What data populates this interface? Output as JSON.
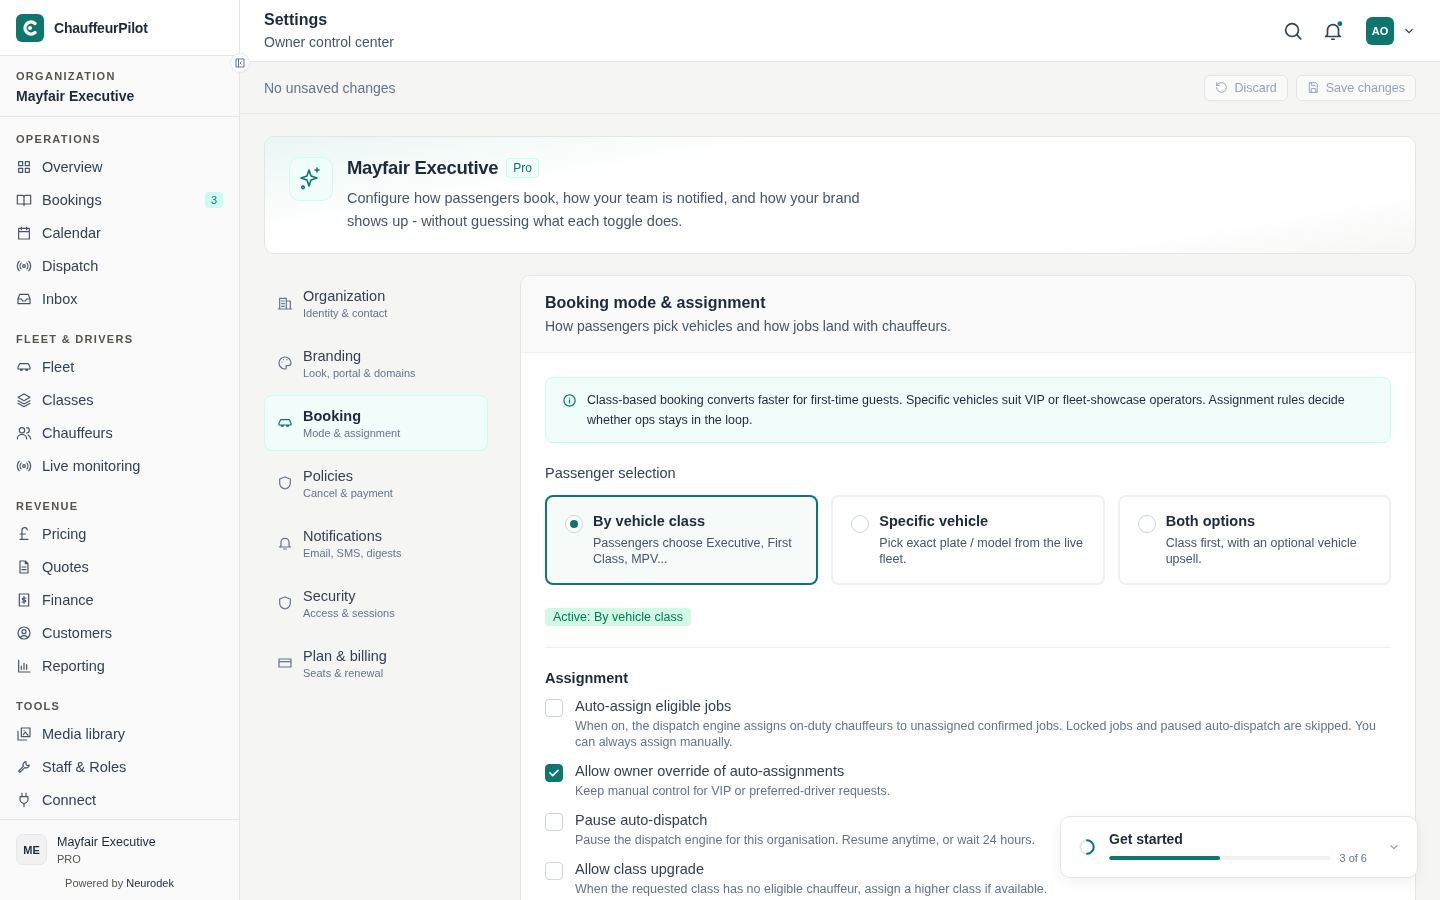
{
  "brand": {
    "name": "ChauffeurPilot"
  },
  "organization": {
    "label": "ORGANIZATION",
    "name": "Mayfair Executive"
  },
  "nav_sections": [
    {
      "title": "OPERATIONS",
      "items": [
        {
          "label": "Overview"
        },
        {
          "label": "Bookings",
          "badge": "3"
        },
        {
          "label": "Calendar"
        },
        {
          "label": "Dispatch"
        },
        {
          "label": "Inbox"
        }
      ]
    },
    {
      "title": "FLEET & DRIVERS",
      "items": [
        {
          "label": "Fleet"
        },
        {
          "label": "Classes"
        },
        {
          "label": "Chauffeurs"
        },
        {
          "label": "Live monitoring"
        }
      ]
    },
    {
      "title": "REVENUE",
      "items": [
        {
          "label": "Pricing"
        },
        {
          "label": "Quotes"
        },
        {
          "label": "Finance"
        },
        {
          "label": "Customers"
        },
        {
          "label": "Reporting"
        }
      ]
    },
    {
      "title": "TOOLS",
      "items": [
        {
          "label": "Media library"
        },
        {
          "label": "Staff & Roles"
        },
        {
          "label": "Connect"
        }
      ]
    }
  ],
  "account": {
    "initials": "ME",
    "name": "Mayfair Executive",
    "plan": "PRO"
  },
  "powered_by": "Powered by **Neurodek**",
  "header": {
    "title": "Settings",
    "subtitle": "Owner control center",
    "avatar": "AO",
    "notification_dot": true
  },
  "save_bar": {
    "status": "No unsaved changes",
    "buttons": [
      {
        "label": "Discard",
        "disabled": true
      },
      {
        "label": "Save changes",
        "disabled": true
      }
    ]
  },
  "hero": {
    "title": "Mayfair Executive",
    "badge": "Pro",
    "description": "Configure how passengers book, how your team is notified, and how your brand shows up - without guessing what each toggle does."
  },
  "settings_nav": [
    {
      "label": "Organization",
      "sub": "Identity & contact",
      "selected": false
    },
    {
      "label": "Branding",
      "sub": "Look, portal & domains",
      "selected": false
    },
    {
      "label": "Booking",
      "sub": "Mode & assignment",
      "selected": true
    },
    {
      "label": "Policies",
      "sub": "Cancel & payment",
      "selected": false
    },
    {
      "label": "Notifications",
      "sub": "Email, SMS, digests",
      "selected": false
    },
    {
      "label": "Security",
      "sub": "Access & sessions",
      "selected": false
    },
    {
      "label": "Plan & billing",
      "sub": "Seats & renewal",
      "selected": false
    }
  ],
  "panel": {
    "title": "Booking mode & assignment",
    "subtitle": "How passengers pick vehicles and how jobs land with chauffeurs.",
    "info": "Class-based booking converts faster for first-time guests. Specific vehicles suit VIP or fleet-showcase operators. Assignment rules decide whether ops stays in the loop.",
    "selection_label": "Passenger selection",
    "options": [
      {
        "title": "By vehicle class",
        "description": "Passengers choose Executive, First Class, MPV...",
        "selected": true
      },
      {
        "title": "Specific vehicle",
        "description": "Pick exact plate / model from the live fleet.",
        "selected": false
      },
      {
        "title": "Both options",
        "description": "Class first, with an optional vehicle upsell.",
        "selected": false
      }
    ],
    "active_tag": "Active: By vehicle class",
    "assignment_label": "Assignment",
    "toggles": [
      {
        "label": "Auto-assign eligible jobs",
        "description": "When on, the dispatch engine assigns on-duty chauffeurs to unassigned confirmed jobs. Locked jobs and paused auto-dispatch are skipped. You can always assign manually.",
        "checked": false
      },
      {
        "label": "Allow owner override of auto-assignments",
        "description": "Keep manual control for VIP or preferred-driver requests.",
        "checked": true
      },
      {
        "label": "Pause auto-dispatch",
        "description": "Pause the dispatch engine for this organisation. Resume anytime, or wait 24 hours.",
        "checked": false
      },
      {
        "label": "Allow class upgrade",
        "description": "When the requested class has no eligible chauffeur, assign a higher class if available.",
        "checked": false
      }
    ]
  },
  "onboarding": {
    "title": "Get started",
    "progress": "3 of 6",
    "level": 0.5
  }
}
